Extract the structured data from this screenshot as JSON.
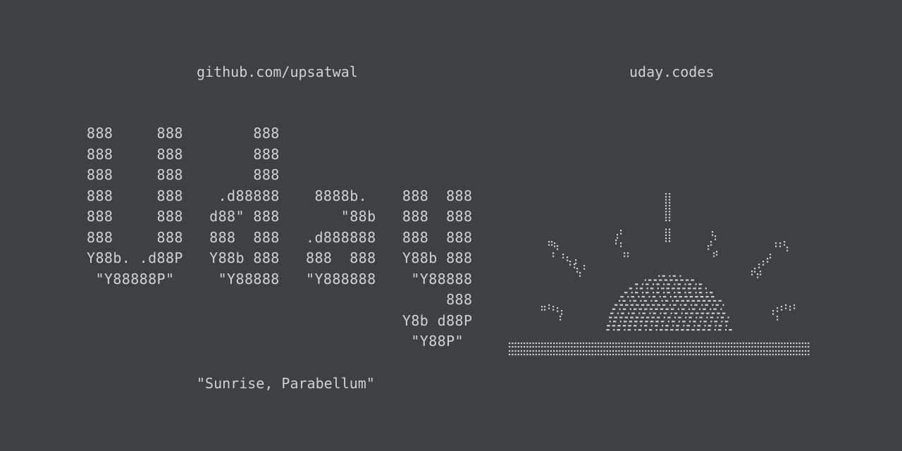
{
  "header": {
    "github_link": "github.com/upsatwal",
    "site_link": "uday.codes"
  },
  "ascii_logo": {
    "lines": [
      "888     888        888",
      "888     888        888",
      "888     888        888",
      "888     888    .d88888    8888b.    888  888",
      "888     888   d88\" 888       \"88b   888  888",
      "888     888   888  888   .d888888   888  888",
      "Y88b. .d88P   Y88b 888   888  888   Y88b 888",
      " \"Y88888P\"     \"Y88888   \"Y888888    \"Y88888",
      "                                         888",
      "                                    Y8b d88P",
      "                                     \"Y88P\""
    ]
  },
  "tagline": "\"Sunrise, Parabellum\"",
  "art": {
    "icon": "sunrise-braille-art",
    "color": "#cfd0d2"
  }
}
